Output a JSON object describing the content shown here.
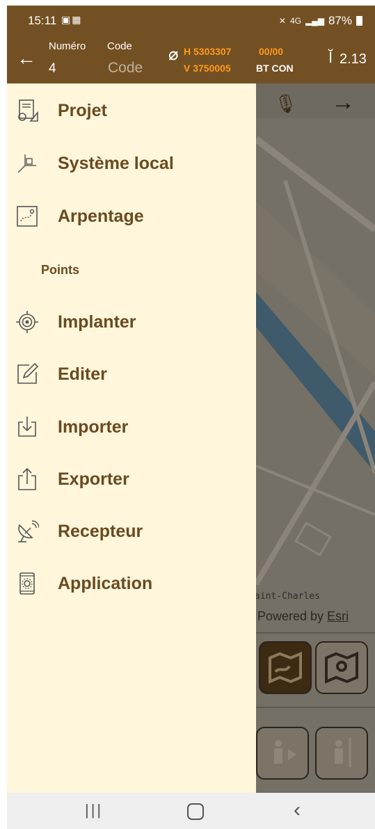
{
  "status_bar": {
    "time": "15:11",
    "left_icons": [
      "gallery-icon",
      "qr-icon"
    ],
    "network": "4G",
    "battery": "87%"
  },
  "app_bar": {
    "numero_label": "Numéro",
    "numero_value": "4",
    "code_label": "Code",
    "code_placeholder": "Code",
    "h_coord": "H 5303307",
    "v_coord": "V 3750005",
    "ratio": "00/00",
    "connection": "BT CON",
    "rod_height": "2.13"
  },
  "drawer": {
    "items_top": [
      {
        "label": "Projet",
        "icon": "project-icon"
      },
      {
        "label": "Système local",
        "icon": "local-system-icon"
      },
      {
        "label": "Arpentage",
        "icon": "survey-icon"
      }
    ],
    "section_label": "Points",
    "items_points": [
      {
        "label": "Implanter",
        "icon": "target-icon"
      },
      {
        "label": "Editer",
        "icon": "edit-icon"
      },
      {
        "label": "Importer",
        "icon": "import-icon"
      },
      {
        "label": "Exporter",
        "icon": "export-icon"
      },
      {
        "label": "Recepteur",
        "icon": "satellite-dish-icon"
      },
      {
        "label": "Application",
        "icon": "app-settings-icon"
      }
    ]
  },
  "map": {
    "place_label": "aint-Charles",
    "credit_prefix": "Powered by",
    "credit_link": "Esri"
  },
  "colors": {
    "header": "#735023",
    "drawer_bg": "#fff6dc",
    "drawer_text": "#6a4a1f",
    "coord_accent": "#ff9a1f"
  }
}
